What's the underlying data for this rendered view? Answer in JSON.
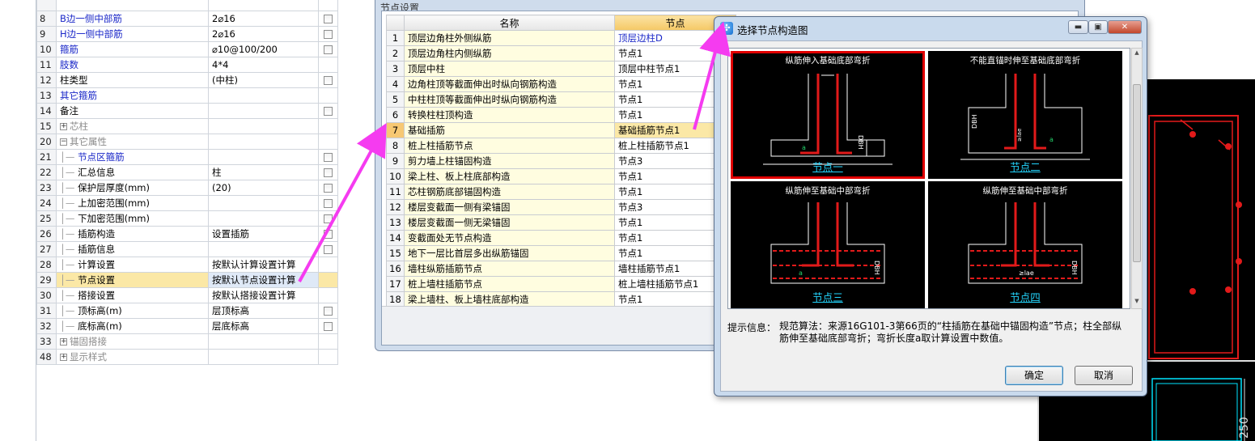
{
  "left_grid": {
    "rows": [
      {
        "num": "",
        "name": "",
        "value": "",
        "check": false,
        "name_class": ""
      },
      {
        "num": "8",
        "name": "B边一侧中部筋",
        "value": "2⌀16",
        "check": true,
        "name_class": "blue"
      },
      {
        "num": "9",
        "name": "H边一侧中部筋",
        "value": "2⌀16",
        "check": true,
        "name_class": "blue"
      },
      {
        "num": "10",
        "name": "箍筋",
        "value": "⌀10@100/200",
        "check": true,
        "name_class": "blue"
      },
      {
        "num": "11",
        "name": "肢数",
        "value": "4*4",
        "check": false,
        "name_class": "blue"
      },
      {
        "num": "12",
        "name": "柱类型",
        "value": "(中柱)",
        "check": true,
        "name_class": ""
      },
      {
        "num": "13",
        "name": "其它箍筋",
        "value": "",
        "check": false,
        "name_class": "blue"
      },
      {
        "num": "14",
        "name": "备注",
        "value": "",
        "check": true,
        "name_class": ""
      },
      {
        "num": "15",
        "name": "芯柱",
        "value": "",
        "check": false,
        "name_class": "gray"
      },
      {
        "num": "20",
        "name": "其它属性",
        "value": "",
        "check": false,
        "name_class": "gray"
      },
      {
        "num": "21",
        "name": "节点区箍筋",
        "value": "",
        "check": true,
        "name_class": "blue"
      },
      {
        "num": "22",
        "name": "汇总信息",
        "value": "柱",
        "check": true,
        "name_class": ""
      },
      {
        "num": "23",
        "name": "保护层厚度(mm)",
        "value": "(20)",
        "check": true,
        "name_class": ""
      },
      {
        "num": "24",
        "name": "上加密范围(mm)",
        "value": "",
        "check": true,
        "name_class": ""
      },
      {
        "num": "25",
        "name": "下加密范围(mm)",
        "value": "",
        "check": true,
        "name_class": ""
      },
      {
        "num": "26",
        "name": "插筋构造",
        "value": "设置插筋",
        "check": true,
        "name_class": ""
      },
      {
        "num": "27",
        "name": "插筋信息",
        "value": "",
        "check": true,
        "name_class": ""
      },
      {
        "num": "28",
        "name": "计算设置",
        "value": "按默认计算设置计算",
        "check": false,
        "name_class": ""
      },
      {
        "num": "29",
        "name": "节点设置",
        "value": "按默认节点设置计算",
        "check": false,
        "name_class": ""
      },
      {
        "num": "30",
        "name": "搭接设置",
        "value": "按默认搭接设置计算",
        "check": false,
        "name_class": ""
      },
      {
        "num": "31",
        "name": "顶标高(m)",
        "value": "层顶标高",
        "check": true,
        "name_class": ""
      },
      {
        "num": "32",
        "name": "底标高(m)",
        "value": "层底标高",
        "check": true,
        "name_class": ""
      },
      {
        "num": "33",
        "name": "锚固搭接",
        "value": "",
        "check": false,
        "name_class": "gray"
      },
      {
        "num": "48",
        "name": "显示样式",
        "value": "",
        "check": false,
        "name_class": "gray"
      }
    ]
  },
  "mid_window": {
    "title": "节点设置",
    "header_name": "名称",
    "header_node": "节点",
    "rows": [
      {
        "num": "1",
        "name": "顶层边角柱外侧纵筋",
        "node": "顶层边柱D"
      },
      {
        "num": "2",
        "name": "顶层边角柱内侧纵筋",
        "node": "节点1"
      },
      {
        "num": "3",
        "name": "顶层中柱",
        "node": "顶层中柱节点1"
      },
      {
        "num": "4",
        "name": "边角柱顶等截面伸出时纵向钢筋构造",
        "node": "节点1"
      },
      {
        "num": "5",
        "name": "中柱柱顶等截面伸出时纵向钢筋构造",
        "node": "节点1"
      },
      {
        "num": "6",
        "name": "转换柱柱顶构造",
        "node": "节点1"
      },
      {
        "num": "7",
        "name": "基础插筋",
        "node": "基础插筋节点1"
      },
      {
        "num": "8",
        "name": "桩上柱插筋节点",
        "node": "桩上柱插筋节点1"
      },
      {
        "num": "9",
        "name": "剪力墙上柱锚固构造",
        "node": "节点3"
      },
      {
        "num": "10",
        "name": "梁上柱、板上柱底部构造",
        "node": "节点1"
      },
      {
        "num": "11",
        "name": "芯柱钢筋底部锚固构造",
        "node": "节点1"
      },
      {
        "num": "12",
        "name": "楼层变截面一侧有梁锚固",
        "node": "节点3"
      },
      {
        "num": "13",
        "name": "楼层变截面一侧无梁锚固",
        "node": "节点1"
      },
      {
        "num": "14",
        "name": "变截面处无节点构造",
        "node": "节点1"
      },
      {
        "num": "15",
        "name": "地下一层比首层多出纵筋锚固",
        "node": "节点1"
      },
      {
        "num": "16",
        "name": "墙柱纵筋插筋节点",
        "node": "墙柱插筋节点1"
      },
      {
        "num": "17",
        "name": "桩上墙柱插筋节点",
        "node": "桩上墙柱插筋节点1"
      },
      {
        "num": "18",
        "name": "梁上墙柱、板上墙柱底部构造",
        "node": "节点1"
      }
    ]
  },
  "dialog": {
    "title": "选择节点构造图",
    "thumbnails": [
      {
        "title": "纵筋伸入基础底部弯折",
        "label": "节点一",
        "selected": true
      },
      {
        "title": "不能直锚时伸至基础底部弯折",
        "label": "节点二",
        "selected": false
      },
      {
        "title": "纵筋伸至基础中部弯折",
        "label": "节点三",
        "selected": false
      },
      {
        "title": "纵筋伸至基础中部弯折",
        "label": "节点四",
        "selected": false
      }
    ],
    "hint_label": "提示信息：",
    "hint_text": "规范算法：来源16G101-3第66页的“柱插筋在基础中锚固构造”节点；柱全部纵筋伸至基础底部弯折；弯折长度a取计算设置中数值。",
    "ok": "确定",
    "cancel": "取消"
  },
  "bg_cad": {
    "dimension_text": "250"
  },
  "colors": {
    "arrow": "#f53bf0",
    "rebar": "#e21a1a",
    "concrete": "#ffffff",
    "cad_line": "#00e5ff"
  }
}
